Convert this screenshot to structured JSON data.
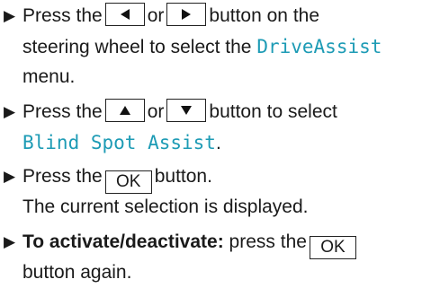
{
  "steps": [
    {
      "text1": "Press the",
      "text2": "or",
      "text3": "button on the",
      "text4": "steering wheel to select the",
      "menu_name": "DriveAssist",
      "text5": "menu.",
      "key_left": "left-triangle-icon",
      "key_right": "right-triangle-icon"
    },
    {
      "text1": "Press the",
      "text2": "or",
      "text3": "button to select",
      "item_name": "Blind Spot Assist",
      "text4": ".",
      "key_up": "up-triangle-icon",
      "key_down": "down-triangle-icon"
    },
    {
      "text1": "Press the",
      "key_label": "OK",
      "text2": "button.",
      "result": "The current selection is displayed."
    },
    {
      "bold_label": "To activate/deactivate:",
      "text1": "press the",
      "key_label": "OK",
      "text2": "button again."
    }
  ]
}
